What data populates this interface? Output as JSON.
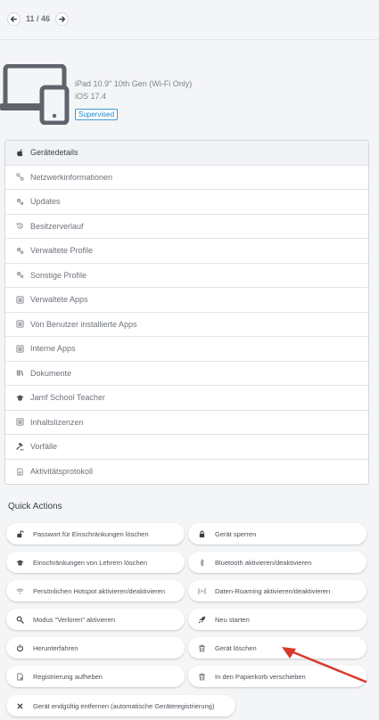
{
  "pager": {
    "text": "11 / 46"
  },
  "device": {
    "name": "iPad 10.9\" 10th Gen (Wi-Fi Only)",
    "os": "iOS 17.4",
    "badge": "Supervised"
  },
  "menu": [
    {
      "label": "Gerätedetails",
      "icon": "apple-icon",
      "active": true
    },
    {
      "label": "Netzwerkinformationen",
      "icon": "network-icon"
    },
    {
      "label": "Updates",
      "icon": "gears-icon"
    },
    {
      "label": "Besitzerverlauf",
      "icon": "history-icon"
    },
    {
      "label": "Verwaltete Profile",
      "icon": "gears-icon"
    },
    {
      "label": "Sonstige Profile",
      "icon": "gears-icon"
    },
    {
      "label": "Verwaltete Apps",
      "icon": "app-icon"
    },
    {
      "label": "Von Benutzer installierte Apps",
      "icon": "app-icon"
    },
    {
      "label": "Interne Apps",
      "icon": "app-icon"
    },
    {
      "label": "Dokumente",
      "icon": "books-icon"
    },
    {
      "label": "Jamf School Teacher",
      "icon": "graduation-cap-icon"
    },
    {
      "label": "Inhaltslizenzen",
      "icon": "app-icon"
    },
    {
      "label": "Vorfälle",
      "icon": "gavel-icon"
    },
    {
      "label": "Aktivitätsprotokoll",
      "icon": "document-icon"
    }
  ],
  "quick_actions": {
    "title": "Quick Actions",
    "buttons": [
      {
        "label": "Passwort für Einschränkungen löschen",
        "icon": "unlock-icon"
      },
      {
        "label": "Gerät sperren",
        "icon": "lock-icon"
      },
      {
        "label": "Einschränkungen von Lehrern löschen",
        "icon": "graduation-cap-icon"
      },
      {
        "label": "Bluetooth aktivieren/deaktivieren",
        "icon": "bluetooth-icon"
      },
      {
        "label": "Persönlichen Hotspot aktivieren/deaktivieren",
        "icon": "wifi-icon"
      },
      {
        "label": "Daten-Roaming aktivieren/deaktivieren",
        "icon": "signal-icon"
      },
      {
        "label": "Modus \"Verloren\" aktivieren",
        "icon": "search-icon"
      },
      {
        "label": "Neu starten",
        "icon": "rocket-icon"
      },
      {
        "label": "Herunterfahren",
        "icon": "power-icon"
      },
      {
        "label": "Gerät löschen",
        "icon": "trash-icon"
      },
      {
        "label": "Registrierung aufheben",
        "icon": "unenroll-icon"
      },
      {
        "label": "In den Papierkorb verschieben",
        "icon": "trash-icon"
      },
      {
        "label": "Gerät endgültig entfernen (automatische Geräteregistrierung)",
        "icon": "close-icon"
      }
    ]
  },
  "colors": {
    "accent": "#1d88c7",
    "annotation_arrow": "#d9392b",
    "background": "#f4f5f7"
  }
}
